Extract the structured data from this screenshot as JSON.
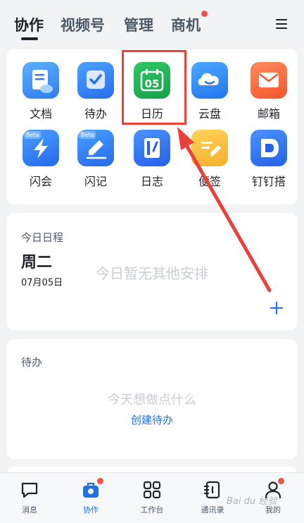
{
  "top_tabs": [
    {
      "label": "协作",
      "active": true
    },
    {
      "label": "视频号",
      "active": false
    },
    {
      "label": "管理",
      "active": false
    },
    {
      "label": "商机",
      "active": false,
      "badge_dot": true
    }
  ],
  "apps": [
    {
      "label": "文档",
      "icon": "document-icon",
      "color": "#2f89ff"
    },
    {
      "label": "待办",
      "icon": "todo-check-icon",
      "color": "#2f7cf6"
    },
    {
      "label": "日历",
      "icon": "calendar-icon",
      "color": "#21b25a",
      "icon_text": "05"
    },
    {
      "label": "云盘",
      "icon": "cloud-drive-icon",
      "color": "#2f86f6"
    },
    {
      "label": "邮箱",
      "icon": "mail-icon",
      "color": "#fe6b3c"
    },
    {
      "label": "闪会",
      "icon": "flash-meeting-icon",
      "color": "#2f7cf6",
      "badge": "Beta"
    },
    {
      "label": "闪记",
      "icon": "flash-note-icon",
      "color": "#2f7cf6",
      "badge": "Beta"
    },
    {
      "label": "日志",
      "icon": "log-book-icon",
      "color": "#2f7cf6"
    },
    {
      "label": "便签",
      "icon": "sticky-note-icon",
      "color": "#fbc23c"
    },
    {
      "label": "钉钉搭",
      "icon": "dingtalk-builder-icon",
      "color": "#2f7cf6"
    }
  ],
  "schedule": {
    "title": "今日日程",
    "weekday": "周二",
    "date": "07月05日",
    "empty_text": "今日暂无其他安排"
  },
  "todo": {
    "title": "待办",
    "empty_text": "今天想做点什么",
    "create_label": "创建待办"
  },
  "bottom_nav": [
    {
      "label": "消息",
      "icon": "message-icon",
      "active": false
    },
    {
      "label": "协作",
      "icon": "collab-bag-icon",
      "active": true,
      "badge_dot": true
    },
    {
      "label": "工作台",
      "icon": "workbench-grid-icon",
      "active": false
    },
    {
      "label": "通讯录",
      "icon": "contacts-icon",
      "active": false
    },
    {
      "label": "我的",
      "icon": "profile-icon",
      "active": false,
      "badge_dot": true
    }
  ],
  "watermark": "Bai du 经验",
  "colors": {
    "accent": "#1f6fe6",
    "annotation": "#ec3f3a",
    "badge": "#f0524a"
  }
}
